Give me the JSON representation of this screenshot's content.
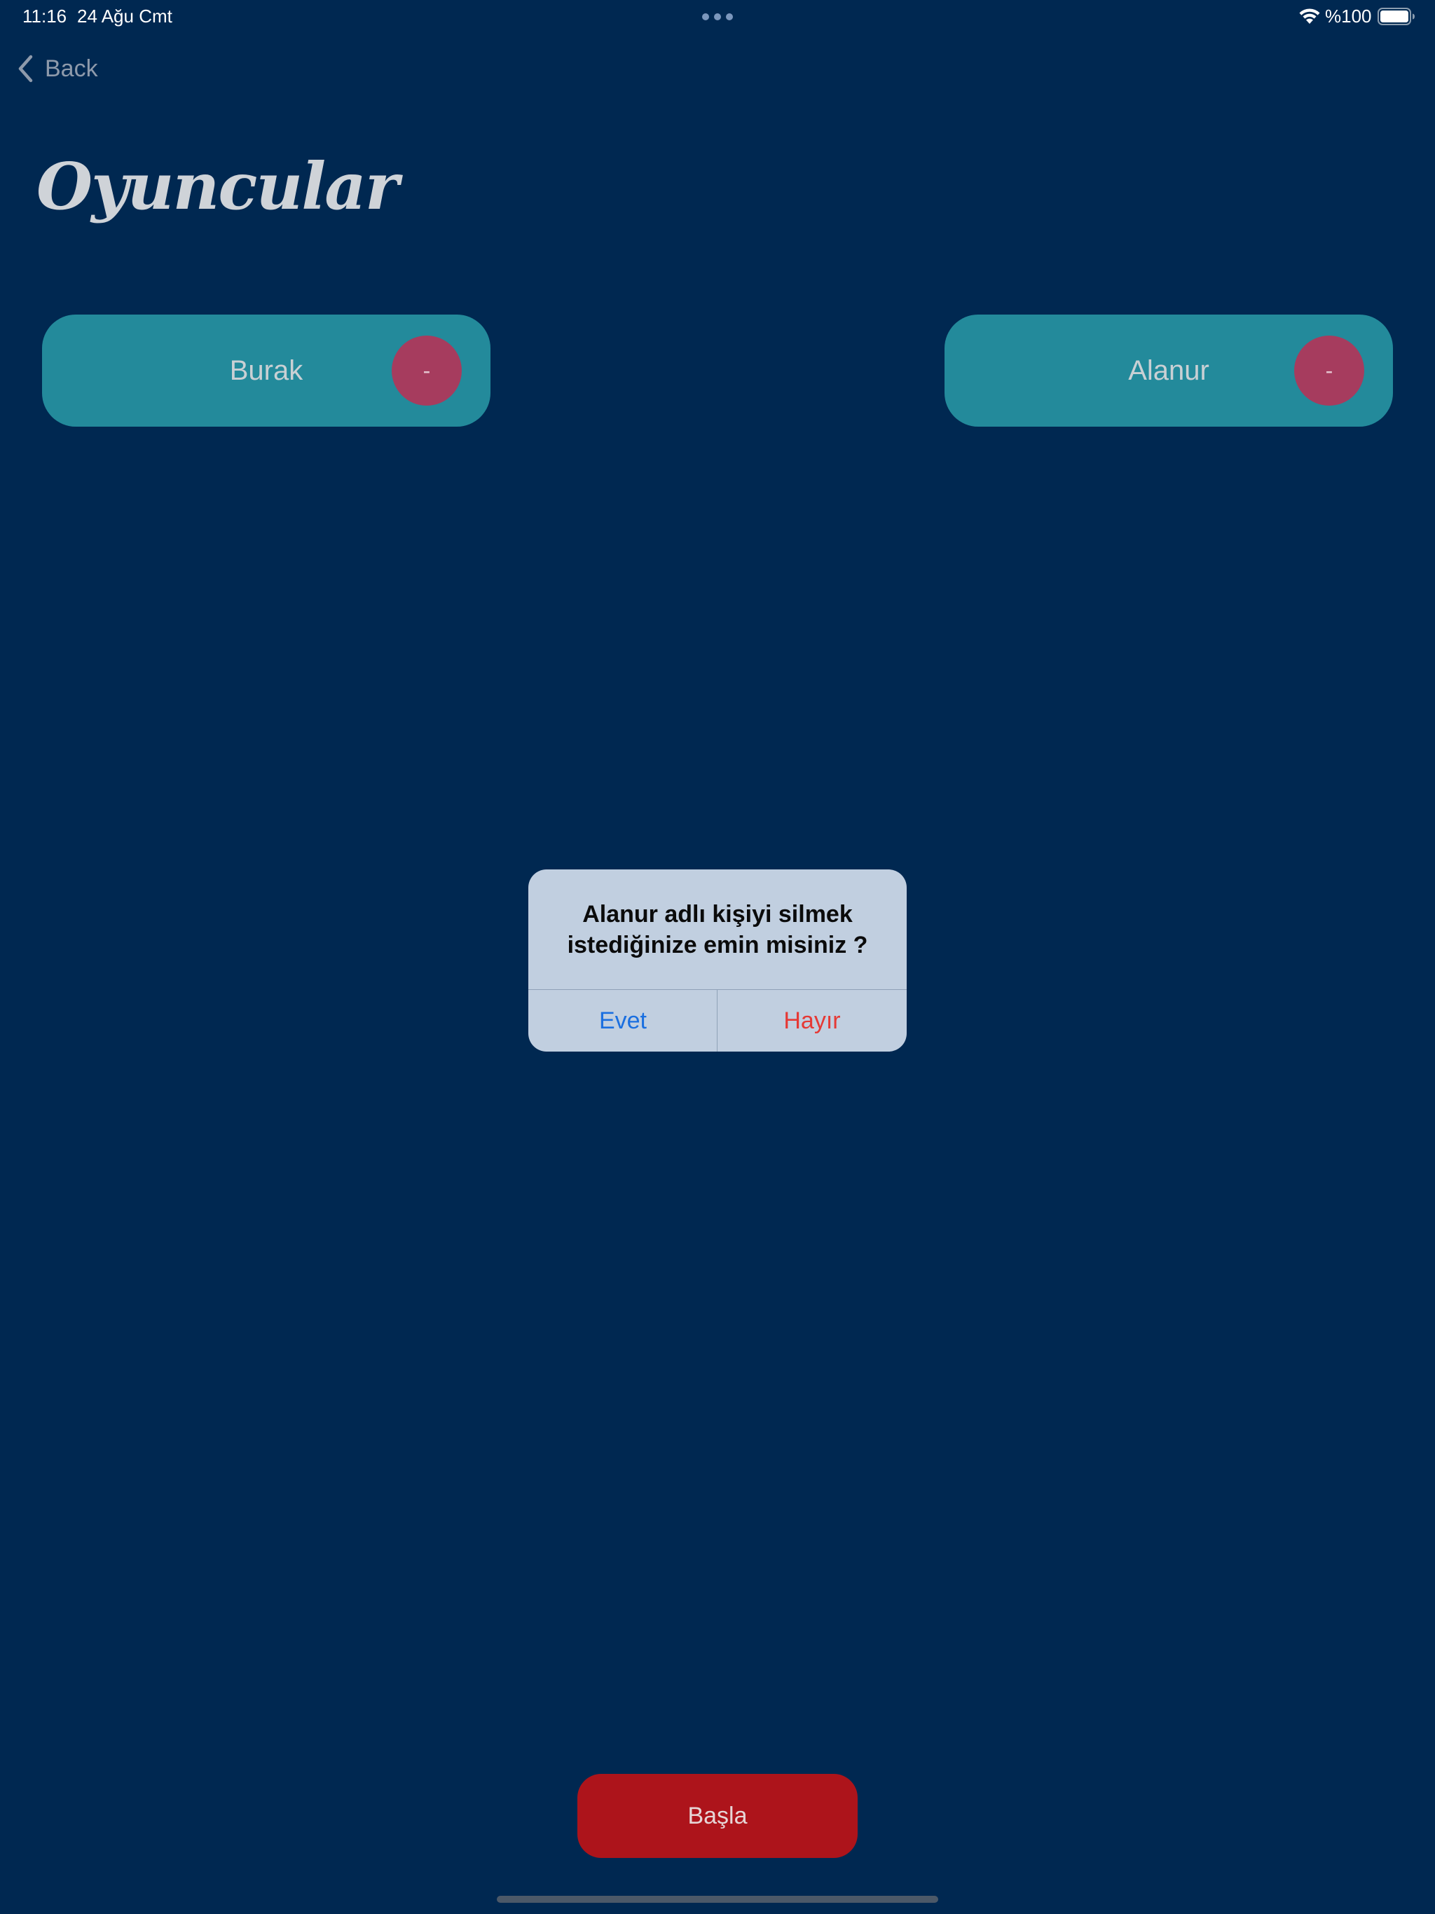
{
  "status_bar": {
    "time": "11:16",
    "date": "24 Ağu Cmt",
    "battery": "%100"
  },
  "nav": {
    "back_label": "Back"
  },
  "page": {
    "title": "Oyuncular"
  },
  "players": [
    {
      "name": "Burak",
      "remove_label": "-"
    },
    {
      "name": "Alanur",
      "remove_label": "-"
    }
  ],
  "alert": {
    "message": "Alanur adlı kişiyi silmek istediğinize emin misiniz ?",
    "confirm_label": "Evet",
    "cancel_label": "Hayır"
  },
  "actions": {
    "start_label": "Başla"
  },
  "colors": {
    "background": "#002851",
    "card": "#238a9b",
    "remove": "#a63c5e",
    "start": "#ad141b",
    "alert_bg": "#c1cfe0",
    "confirm": "#1a6fe0",
    "cancel": "#e53935"
  }
}
